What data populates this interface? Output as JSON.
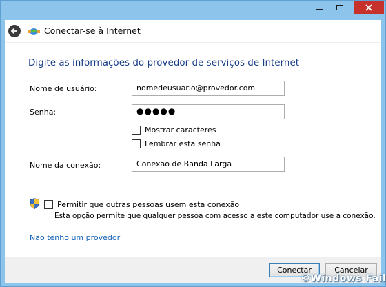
{
  "window": {
    "header_title": "Conectar-se à Internet"
  },
  "form": {
    "heading": "Digite as informações do provedor de serviços de Internet",
    "username_label": "Nome de usuário:",
    "username_value": "nomedeusuario@provedor.com",
    "password_label": "Senha:",
    "password_value": "●●●●●",
    "show_chars_label": "Mostrar caracteres",
    "show_chars_checked": false,
    "remember_label": "Lembrar esta senha",
    "remember_checked": false,
    "connection_label": "Nome da conexão:",
    "connection_value": "Conexão de Banda Larga",
    "allow_label": "Permitir que outras pessoas usem esta conexão",
    "allow_checked": false,
    "allow_description": "Esta opção permite que qualquer pessoa com acesso a este computador use a conexão.",
    "no_provider_link": "Não tenho um provedor"
  },
  "footer": {
    "connect_label": "Conectar",
    "cancel_label": "Cancelar"
  },
  "watermark": "©Windows Fail",
  "colors": {
    "window_frame": "#8cc4ec",
    "heading": "#1a3f8a",
    "link": "#0b5db3",
    "close_button": "#c7312b"
  }
}
